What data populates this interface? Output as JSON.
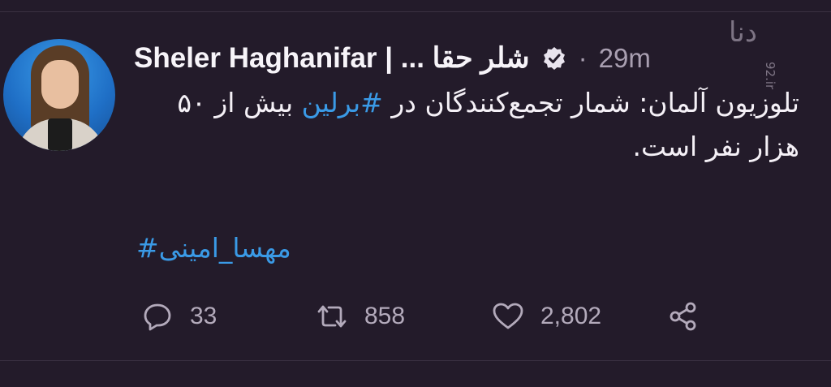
{
  "tweet": {
    "author_name": "Sheler Haghanifar | ... شلر حقا",
    "separator": "·",
    "time": "29m",
    "text": "تلوزیون آلمان: شمار تجمع‌کنندگان در #برلین بیش از ۵۰ هزار نفر است.",
    "text_before_tag": "تلوزیون آلمان: شمار تجمع‌کنندگان در ",
    "inline_hashtag": "#برلین",
    "text_after_tag": " بیش از ۵۰ هزار نفر است.",
    "hashtag_line": "#مهسا_امینی"
  },
  "actions": {
    "replies": "33",
    "retweets": "858",
    "likes": "2,802"
  },
  "watermark": {
    "logo_text": "دنا",
    "site": "92.ir"
  },
  "colors": {
    "background": "#231b2a",
    "link": "#3a9ae6",
    "muted": "#a99fb1"
  },
  "icons": {
    "verified": "verified-badge-icon",
    "reply": "reply-icon",
    "retweet": "retweet-icon",
    "like": "heart-icon",
    "share": "share-icon"
  }
}
